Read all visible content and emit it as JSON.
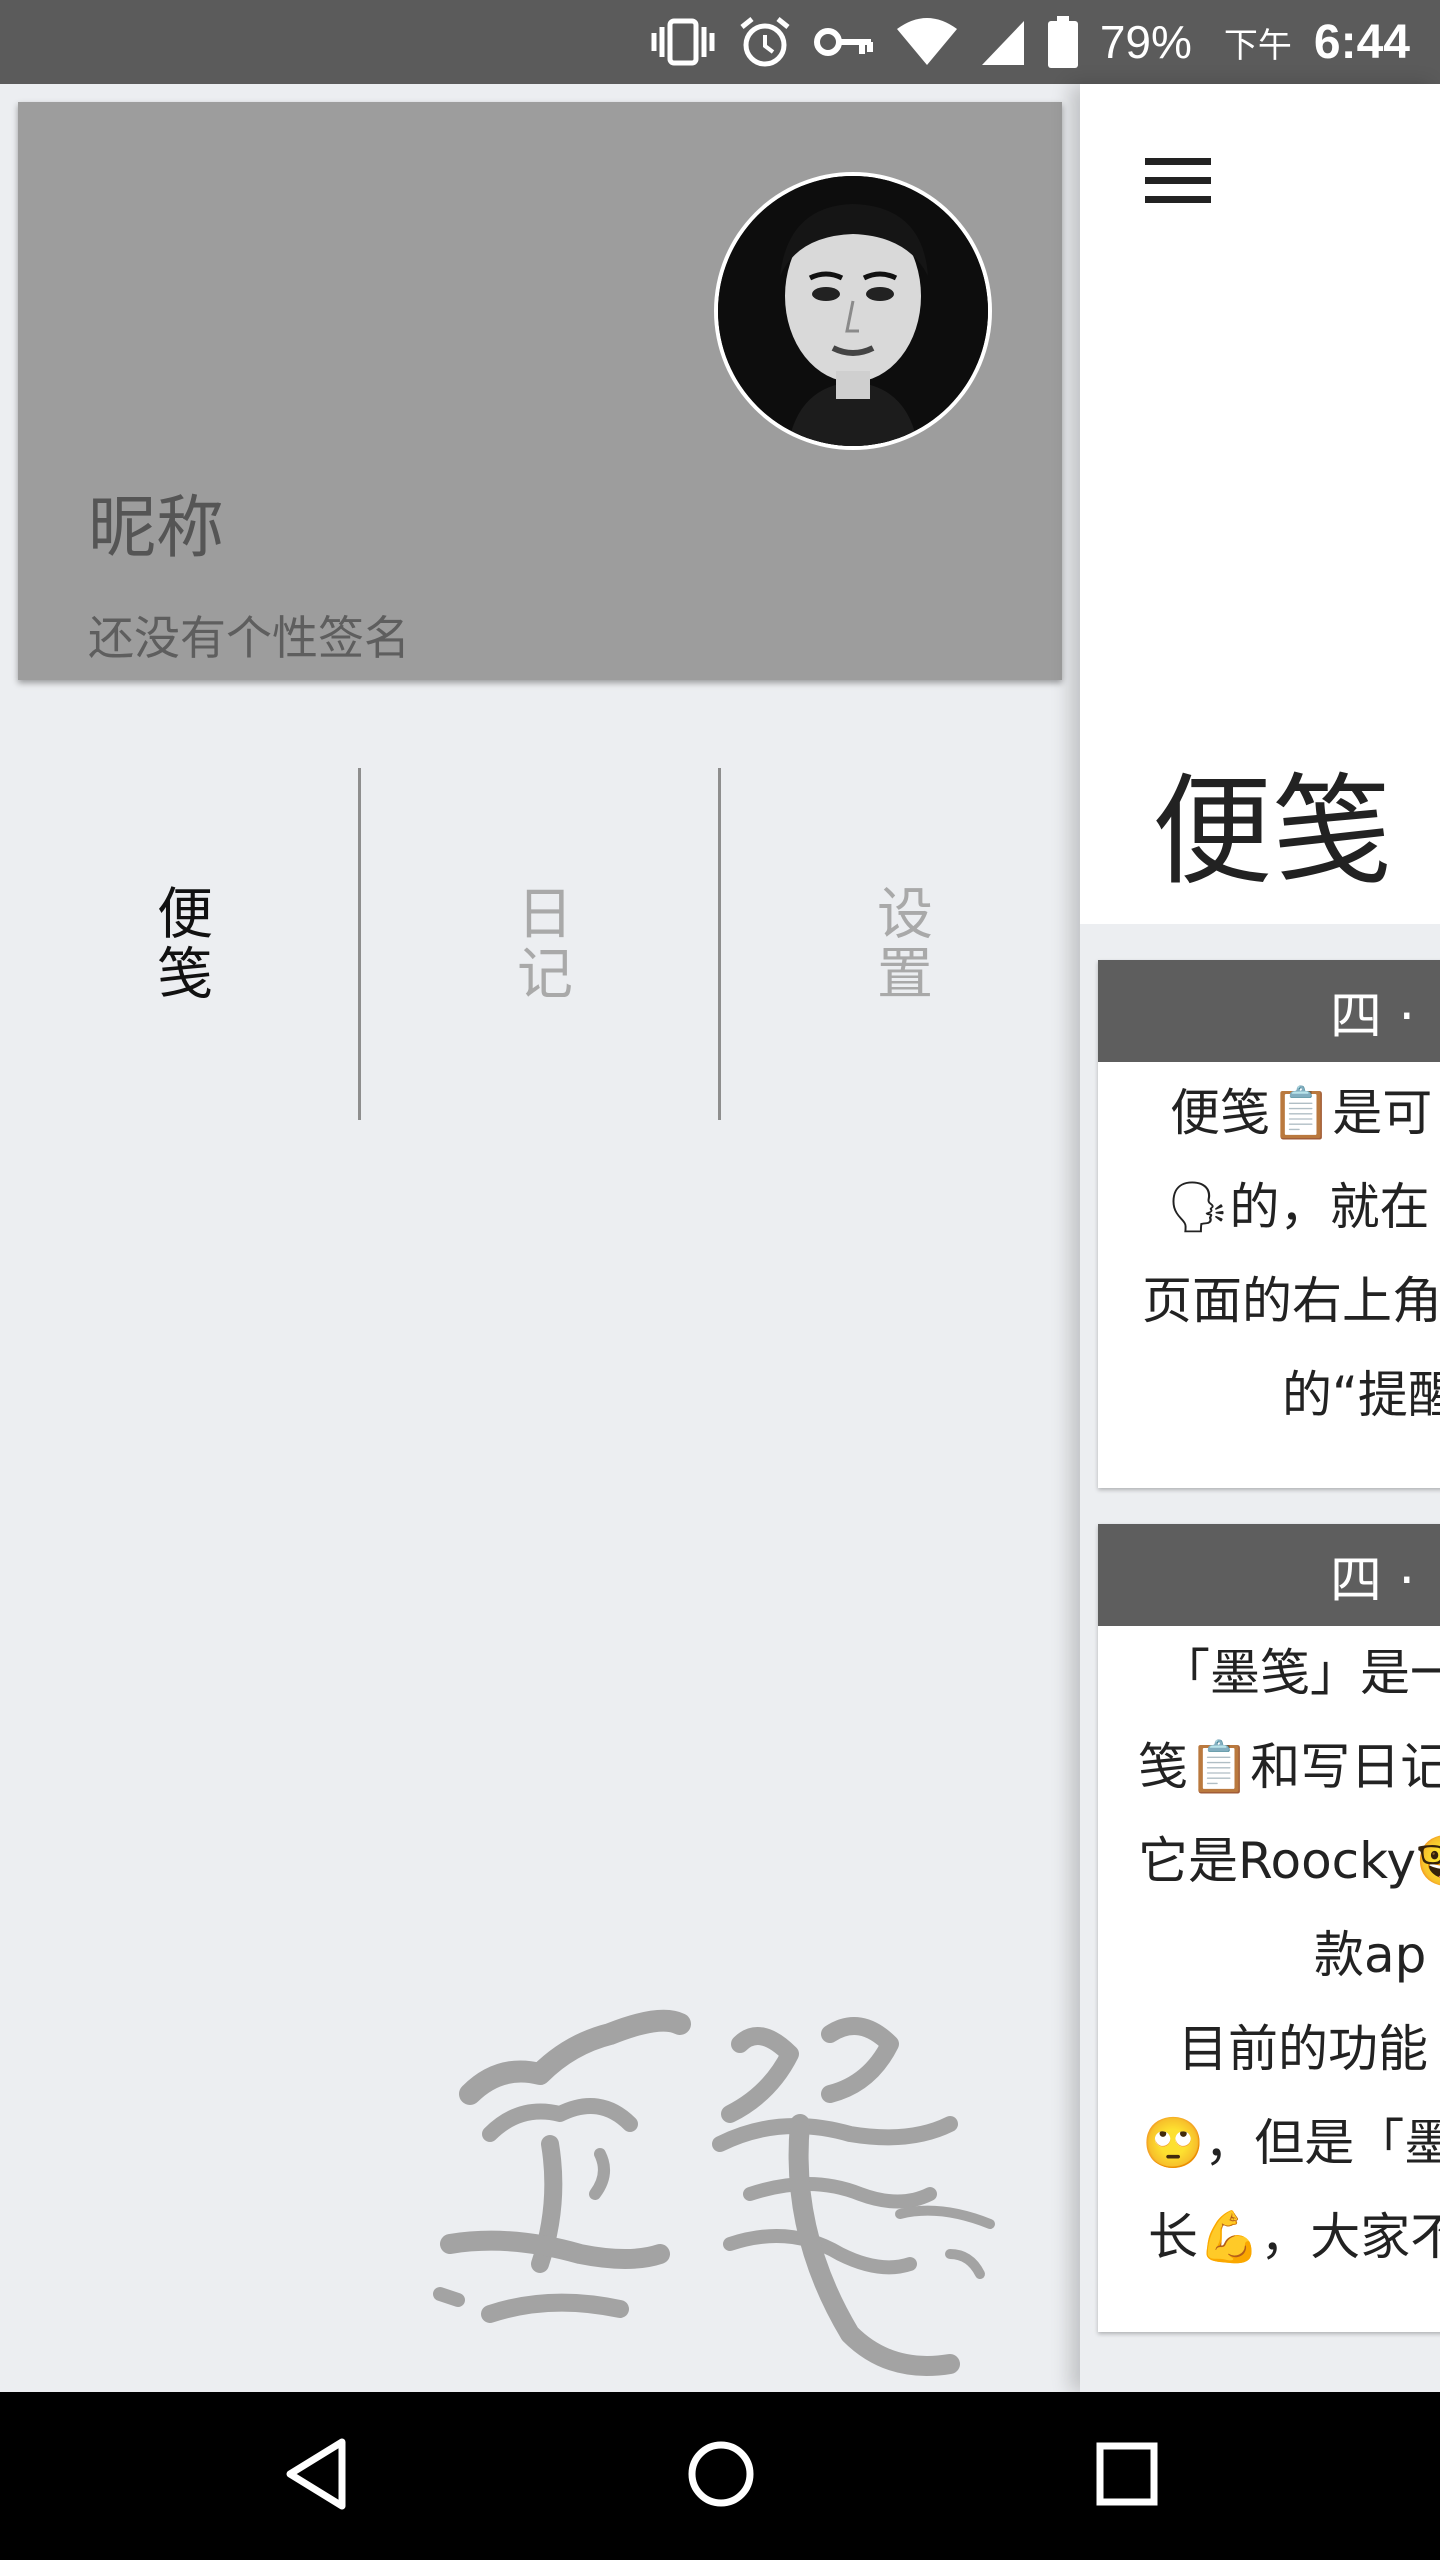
{
  "status_bar": {
    "battery": "79%",
    "ampm": "下午",
    "time": "6:44",
    "icons": [
      "vibrate-icon",
      "alarm-icon",
      "vpn-key-icon",
      "wifi-icon",
      "signal-icon",
      "battery-icon"
    ]
  },
  "drawer": {
    "profile": {
      "nickname": "昵称",
      "signature": "还没有个性签名",
      "card_color": "#9d9d9d"
    },
    "tabs": [
      {
        "label": "便笺",
        "active": true
      },
      {
        "label": "日记",
        "active": false
      },
      {
        "label": "设置",
        "active": false
      }
    ],
    "brand": "墨笺"
  },
  "main": {
    "title": "便笺",
    "notes": [
      {
        "date": "四 · ",
        "lines": [
          "便笺📋是可",
          "🗣的，就在",
          "页面的右上角",
          "的“提醒"
        ]
      },
      {
        "date": "四 · ",
        "lines": [
          "「墨笺」是一",
          "笺📋和写日记",
          "它是Roocky🤓",
          "款ap",
          "目前的功能",
          "🙄，但是「墨",
          "长💪，大家不"
        ]
      }
    ]
  },
  "nav_bar": {
    "buttons": [
      "back-icon",
      "home-icon",
      "recents-icon"
    ]
  }
}
